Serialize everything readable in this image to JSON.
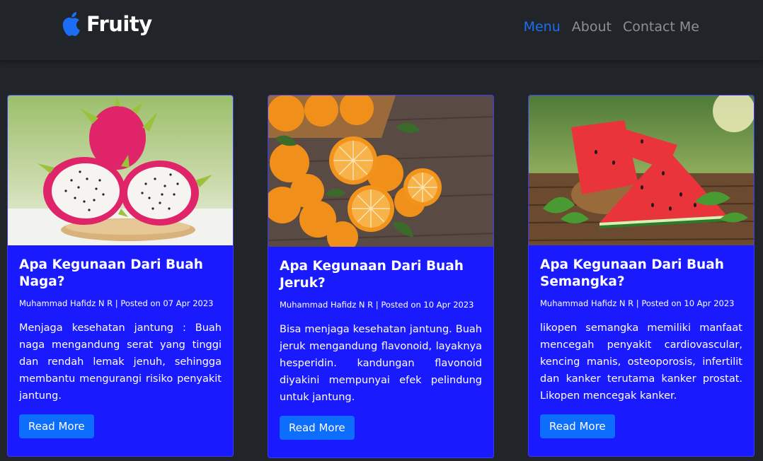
{
  "brand": {
    "name": "Fruity",
    "logo_icon": "apple-icon",
    "logo_color": "#1b6ef3"
  },
  "nav": [
    {
      "label": "Menu",
      "active": true
    },
    {
      "label": "About",
      "active": false
    },
    {
      "label": "Contact Me",
      "active": false
    }
  ],
  "accent_color": "#1a1aff",
  "button_color": "#0d6efd",
  "cards": [
    {
      "image": "dragon-fruit-image",
      "title": "Apa Kegunaan Dari Buah Naga?",
      "meta": "Muhammad Hafidz N R | Posted on 07 Apr 2023",
      "body": "Menjaga kesehatan jantung : Buah naga mengandung serat yang tinggi dan rendah lemak jenuh, sehingga membantu mengurangi risiko penyakit jantung.",
      "button": "Read More"
    },
    {
      "image": "orange-fruit-image",
      "title": "Apa Kegunaan Dari Buah Jeruk?",
      "meta": "Muhammad Hafidz N R | Posted on 10 Apr 2023",
      "body": "Bisa menjaga kesehatan jantung. Buah jeruk mengandung flavonoid, layaknya hesperidin. kandungan flavonoid diyakini mempunyai efek pelindung untuk jantung.",
      "button": "Read More"
    },
    {
      "image": "watermelon-image",
      "title": "Apa Kegunaan Dari Buah Semangka?",
      "meta": "Muhammad Hafidz N R | Posted on 10 Apr 2023",
      "body": "likopen semangka memiliki manfaat mencegah penyakit cardiovascular, kencing manis, osteoporosis, infertilit dan kanker terutama kanker prostat. Likopen mencegak kanker.",
      "button": "Read More"
    }
  ]
}
